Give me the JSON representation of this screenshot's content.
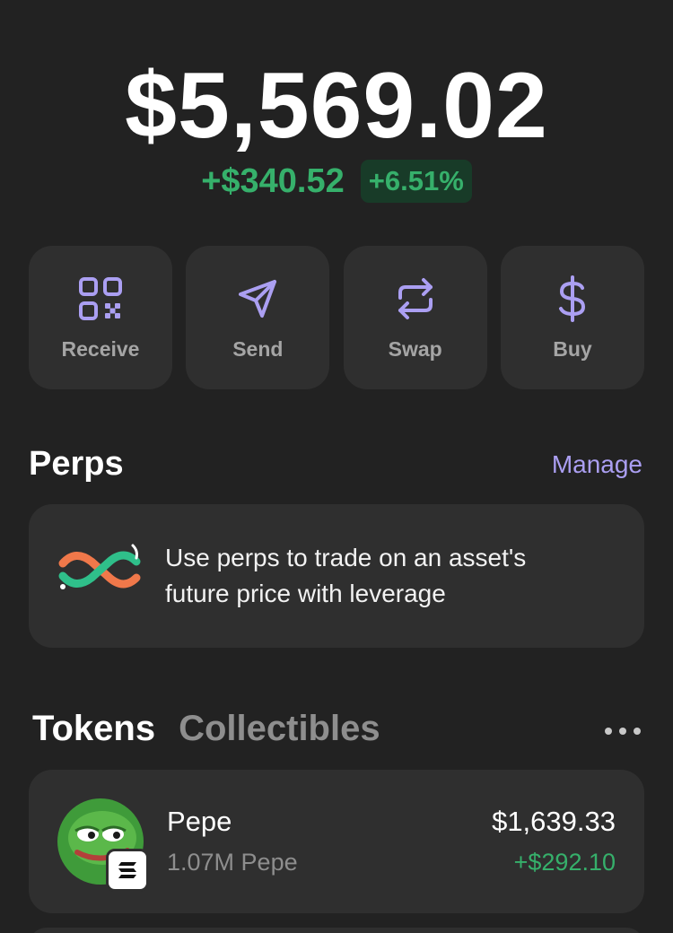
{
  "portfolio": {
    "balance": "$5,569.02",
    "change_amount": "+$340.52",
    "change_percent": "+6.51%"
  },
  "actions": [
    {
      "label": "Receive",
      "icon": "qr-code-icon"
    },
    {
      "label": "Send",
      "icon": "send-icon"
    },
    {
      "label": "Swap",
      "icon": "swap-icon"
    },
    {
      "label": "Buy",
      "icon": "dollar-icon"
    }
  ],
  "perps": {
    "title": "Perps",
    "manage_label": "Manage",
    "description": "Use perps to trade on an asset's future price with leverage",
    "icon": "perps-infinity-icon"
  },
  "tabs": {
    "tokens": "Tokens",
    "collectibles": "Collectibles"
  },
  "tokens": [
    {
      "name": "Pepe",
      "amount": "1.07M Pepe",
      "value": "$1,639.33",
      "change": "+$292.10",
      "icon": "pepe-avatar",
      "chain_icon": "solana-icon"
    }
  ],
  "colors": {
    "background": "#222222",
    "card": "#2f2f2f",
    "accent": "#ab9ff2",
    "positive": "#36b06b",
    "muted": "#8e8e8e"
  }
}
